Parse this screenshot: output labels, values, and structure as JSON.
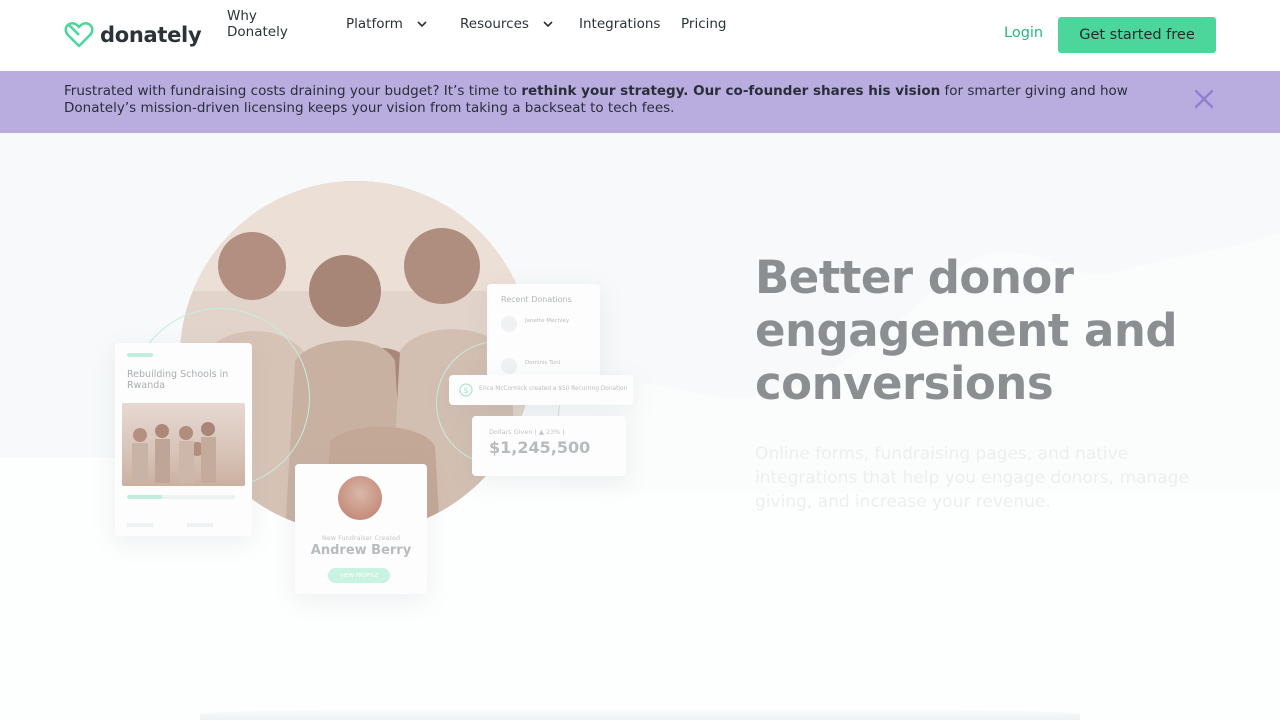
{
  "brand": {
    "name": "donately",
    "accent": "#4cd69c",
    "banner_bg": "#b9ade0"
  },
  "nav": {
    "items": [
      {
        "label": "Why Donately",
        "has_dropdown": false
      },
      {
        "label": "Platform",
        "has_dropdown": true
      },
      {
        "label": "Resources",
        "has_dropdown": true
      },
      {
        "label": "Integrations",
        "has_dropdown": false
      },
      {
        "label": "Pricing",
        "has_dropdown": false
      }
    ],
    "login_label": "Login",
    "cta_label": "Get started free"
  },
  "banner": {
    "text_1": "Frustrated with fundraising costs draining your budget? It’s time to ",
    "bold_1": "rethink your strategy. Our co-founder shares his vision",
    "text_2": " for smarter giving and how Donately’s mission-driven licensing keeps your vision from taking a backseat to tech fees.",
    "close_icon": "close-icon"
  },
  "hero": {
    "title": "Better donor engagement and conversions",
    "subtitle": "Online forms, fundraising pages, and native integrations that help you engage donors, manage giving, and increase your revenue."
  },
  "mockup": {
    "campaign_title": "Rebuilding Schools in Rwanda",
    "campaign_progress": 0.32,
    "recent_title": "Recent Donations",
    "recent_donors": [
      "Janette Mechley",
      "Dominic Tuni"
    ],
    "notice": "Erica McCormick created a $50 Recurring Donation",
    "total_label": "Dollars Given | ▲ 23% |",
    "total_value": "$1,245,500",
    "fundraiser_label": "New Fundraiser Created",
    "fundraiser_name": "Andrew Berry",
    "fundraiser_button": "VIEW PROFILE"
  }
}
